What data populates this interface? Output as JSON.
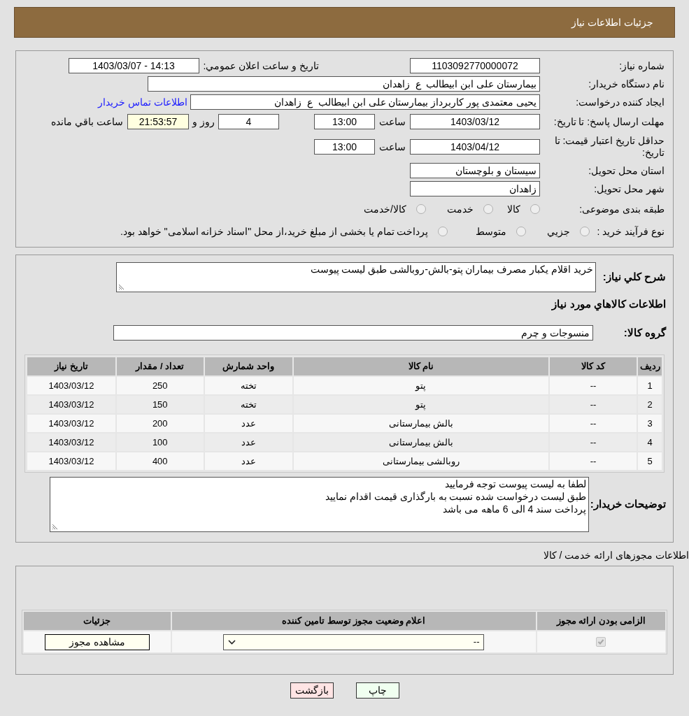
{
  "header": {
    "title": "جزئیات اطلاعات نیاز"
  },
  "need_info": {
    "need_number": {
      "label": "شماره نیاز:",
      "value": "1103092770000072"
    },
    "announce": {
      "label": "تاریخ و ساعت اعلان عمومي:",
      "value": "1403/03/07 - 14:13"
    },
    "buyer_org": {
      "label": "نام دستگاه خریدار:",
      "value": "بیمارستان علی ابن ابیطالب  ع  زاهدان"
    },
    "requester": {
      "label": "ایجاد کننده درخواست:",
      "value": "یحیی معتمدی پور کاربرداز بیمارستان علی ابن ابیطالب  ع  زاهدان",
      "contact_link": "اطلاعات تماس خریدار"
    },
    "reply_deadline": {
      "label": "مهلت ارسال پاسخ: تا تاریخ:",
      "date": "1403/03/12",
      "time_label": "ساعت",
      "time": "13:00",
      "days": "4",
      "days_label": "روز و",
      "remaining": "21:53:57",
      "remaining_label": "ساعت باقي مانده"
    },
    "price_validity": {
      "label": "حداقل تاریخ اعتبار قیمت: تا تاریخ:",
      "date": "1403/04/12",
      "time_label": "ساعت",
      "time": "13:00"
    },
    "province": {
      "label": "استان محل تحویل:",
      "value": "سیستان و بلوچستان"
    },
    "city": {
      "label": "شهر محل تحویل:",
      "value": "زاهدان"
    },
    "category": {
      "label": "طبقه بندی موضوعی:",
      "options": [
        {
          "label": "کالا",
          "selected": false
        },
        {
          "label": "خدمت",
          "selected": false
        },
        {
          "label": "کالا/خدمت",
          "selected": false
        }
      ]
    },
    "process": {
      "label": "نوع فرآیند خرید :",
      "options": [
        {
          "label": "جزيي",
          "selected": false
        },
        {
          "label": "متوسط",
          "selected": false
        },
        {
          "label": "پرداخت تمام یا بخشی از مبلغ خرید،از محل \"اسناد خزانه اسلامی\" خواهد بود.",
          "selected": false
        }
      ]
    }
  },
  "goods": {
    "summary": {
      "label": "شرح کلي نیاز:",
      "value": "خرید اقلام یکبار مصرف بیماران پتو-بالش-روبالشی طبق لیست پیوست"
    },
    "heading": "اطلاعات کالاهاي مورد نياز",
    "group": {
      "label": "گروه کالا:",
      "value": "منسوجات و چرم"
    },
    "table": {
      "columns": [
        "ردیف",
        "کد کالا",
        "نام کالا",
        "واحد شمارش",
        "تعداد / مقدار",
        "تاریخ نیاز"
      ],
      "rows": [
        [
          "1",
          "--",
          "پتو",
          "تخته",
          "250",
          "1403/03/12"
        ],
        [
          "2",
          "--",
          "پتو",
          "تخته",
          "150",
          "1403/03/12"
        ],
        [
          "3",
          "--",
          "بالش بیمارستانی",
          "عدد",
          "200",
          "1403/03/12"
        ],
        [
          "4",
          "--",
          "بالش بیمارستانی",
          "عدد",
          "100",
          "1403/03/12"
        ],
        [
          "5",
          "--",
          "روبالشی بیمارستانی",
          "عدد",
          "400",
          "1403/03/12"
        ]
      ]
    },
    "buyer_notes": {
      "label": "توضیحات خریدار:",
      "value": "لطفا به لیست پیوست توجه فرمایید\nطبق لیست درخواست شده نسبت به بارگذاری قیمت اقدام نمایید\nپرداخت سند 4 الی 6 ماهه می باشد"
    }
  },
  "permits": {
    "title": "اطلاعات مجوزهای ارائه خدمت / کالا",
    "columns": [
      "الزامی بودن ارائه مجوز",
      "اعلام وضعیت مجوز توسط تامین کننده",
      "جزئیات"
    ],
    "rows": [
      {
        "required": true,
        "status": "--",
        "details_button": "مشاهده مجوز"
      }
    ]
  },
  "buttons": [
    {
      "kind": "print",
      "label": "چاپ"
    },
    {
      "kind": "back",
      "label": "بازگشت"
    }
  ]
}
